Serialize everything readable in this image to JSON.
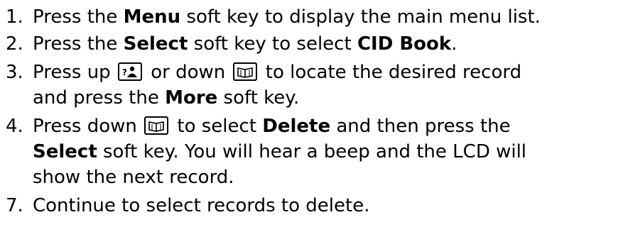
{
  "steps": [
    {
      "number": "1.",
      "parts": [
        "Press the ",
        "Menu",
        " soft key to display the main menu list."
      ]
    },
    {
      "number": "2.",
      "parts": [
        "Press the ",
        "Select",
        " soft key to select ",
        "CID Book",
        "."
      ]
    },
    {
      "number": "3.",
      "line1": [
        "Press up ",
        " or down ",
        " to locate the desired record"
      ],
      "line2": [
        "and press the ",
        "More",
        " soft key."
      ],
      "icons": [
        "up-key-icon",
        "down-key-icon"
      ]
    },
    {
      "number": "4.",
      "line1": [
        "Press down ",
        " to select ",
        "Delete",
        " and then press the"
      ],
      "line2": [
        "Select",
        " soft key. You will hear a beep and the LCD will"
      ],
      "line3": "show the next record.",
      "icons": [
        "down-key-icon"
      ]
    },
    {
      "number": "7.",
      "parts": [
        "Continue to select records to delete."
      ]
    }
  ]
}
